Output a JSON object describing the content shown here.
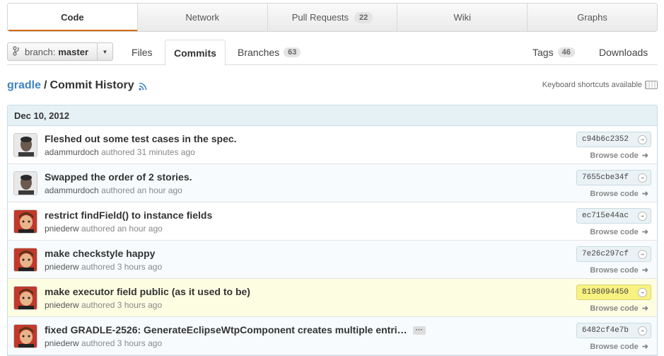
{
  "tabs": [
    {
      "label": "Code",
      "count": null,
      "active": true
    },
    {
      "label": "Network",
      "count": null,
      "active": false
    },
    {
      "label": "Pull Requests",
      "count": "22",
      "active": false
    },
    {
      "label": "Wiki",
      "count": null,
      "active": false
    },
    {
      "label": "Graphs",
      "count": null,
      "active": false
    }
  ],
  "branch": {
    "prefix": "branch:",
    "name": "master"
  },
  "subnav": {
    "files": "Files",
    "commits": "Commits",
    "branches": "Branches",
    "branches_count": "63",
    "tags": "Tags",
    "tags_count": "46",
    "downloads": "Downloads"
  },
  "heading": {
    "repo": "gradle",
    "sep": "/",
    "title": "Commit History"
  },
  "keyboard_hint": "Keyboard shortcuts available",
  "group_date": "Dec 10, 2012",
  "commits": [
    {
      "message": "Fleshed out some test cases in the spec.",
      "author": "adammurdoch",
      "authored": "authored 31 minutes ago",
      "sha": "c94b6c2352",
      "browse": "Browse code",
      "avatar": "person-a"
    },
    {
      "message": "Swapped the order of 2 stories.",
      "author": "adammurdoch",
      "authored": "authored an hour ago",
      "sha": "7655cbe34f",
      "browse": "Browse code",
      "avatar": "person-a"
    },
    {
      "message": "restrict findField() to instance fields",
      "author": "pniederw",
      "authored": "authored an hour ago",
      "sha": "ec715e44ac",
      "browse": "Browse code",
      "avatar": "person-b"
    },
    {
      "message": "make checkstyle happy",
      "author": "pniederw",
      "authored": "authored 3 hours ago",
      "sha": "7e26c297cf",
      "browse": "Browse code",
      "avatar": "person-b"
    },
    {
      "message": "make executor field public (as it used to be)",
      "author": "pniederw",
      "authored": "authored 3 hours ago",
      "sha": "8198094450",
      "browse": "Browse code",
      "avatar": "person-b"
    },
    {
      "message": "fixed GRADLE-2526: GenerateEclipseWtpComponent creates multiple entri…",
      "author": "pniederw",
      "authored": "authored 3 hours ago",
      "sha": "6482cf4e7b",
      "browse": "Browse code",
      "avatar": "person-b"
    }
  ],
  "more_label": "···"
}
